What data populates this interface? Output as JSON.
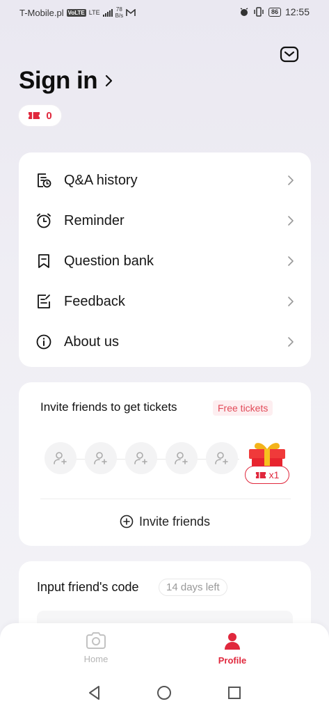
{
  "status_bar": {
    "carrier": "T-Mobile.pl",
    "volte": "VoLTE",
    "network": "LTE",
    "speed_value": "78",
    "speed_unit": "B/s",
    "battery": "86",
    "time": "12:55"
  },
  "header": {
    "title": "Sign in",
    "ticket_count": "0",
    "mail_icon": "mail-icon"
  },
  "menu": {
    "items": [
      {
        "label": "Q&A history",
        "icon": "history-icon"
      },
      {
        "label": "Reminder",
        "icon": "alarm-clock-icon"
      },
      {
        "label": "Question bank",
        "icon": "bookmark-icon"
      },
      {
        "label": "Feedback",
        "icon": "edit-note-icon"
      },
      {
        "label": "About us",
        "icon": "info-icon"
      }
    ]
  },
  "invite": {
    "title": "Invite friends to get tickets",
    "badge": "Free tickets",
    "reward": "x1",
    "button_label": "Invite friends",
    "slots": 5
  },
  "friend_code": {
    "title": "Input friend's code",
    "days_left": "14 days left"
  },
  "bottom_nav": {
    "home_label": "Home",
    "profile_label": "Profile",
    "active": "Profile"
  },
  "colors": {
    "accent": "#e0283d",
    "inactive": "#b5b5b5"
  }
}
